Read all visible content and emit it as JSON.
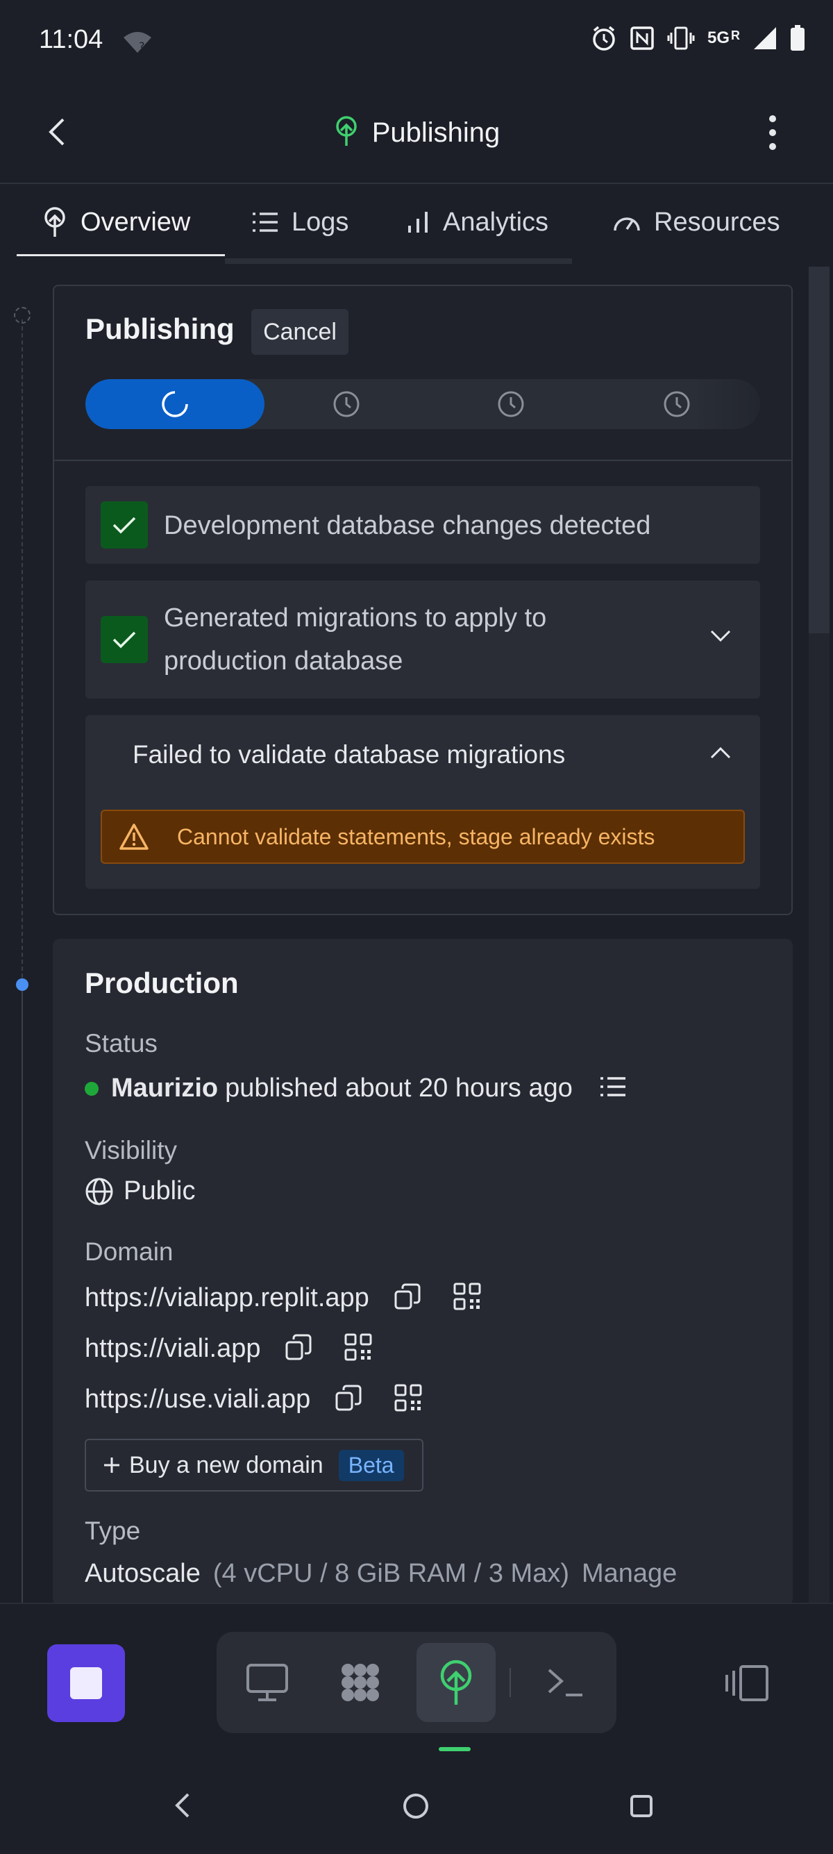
{
  "status_bar": {
    "time": "11:04",
    "network": "5G",
    "roaming": "R"
  },
  "header": {
    "title": "Publishing"
  },
  "tabs": [
    {
      "label": "Overview",
      "icon": "publish-tree-icon"
    },
    {
      "label": "Logs",
      "icon": "list-icon"
    },
    {
      "label": "Analytics",
      "icon": "bar-chart-icon"
    },
    {
      "label": "Resources",
      "icon": "gauge-icon"
    }
  ],
  "publishing": {
    "title": "Publishing",
    "cancel_label": "Cancel",
    "steps": [
      {
        "state": "in-progress",
        "icon": "spinner-icon"
      },
      {
        "state": "pending",
        "icon": "clock-icon"
      },
      {
        "state": "pending",
        "icon": "clock-icon"
      },
      {
        "state": "pending",
        "icon": "clock-icon"
      }
    ],
    "checks": [
      {
        "text": "Development database changes detected",
        "status": "done"
      },
      {
        "text_line1": "Generated migrations to apply to",
        "text_line2": "production database",
        "status": "done"
      }
    ],
    "failure": {
      "title": "Failed to validate database migrations",
      "error": "Cannot validate statements, stage already exists"
    }
  },
  "production": {
    "title": "Production",
    "status_label": "Status",
    "status_user": "Maurizio",
    "status_text": "published about 20 hours ago",
    "visibility_label": "Visibility",
    "visibility_value": "Public",
    "domain_label": "Domain",
    "domains": [
      "https://vialiapp.replit.app",
      "https://viali.app",
      "https://use.viali.app"
    ],
    "buy_domain_label": "Buy a new domain",
    "beta_label": "Beta",
    "type_label": "Type",
    "type_value": "Autoscale",
    "type_spec": "(4 vCPU / 8 GiB RAM / 3 Max)",
    "manage_label": "Manage"
  },
  "colors": {
    "accent_blue": "#0a5fc6",
    "success_green": "#0b5a1d",
    "warning_bg": "#5c2f05",
    "warning_text": "#f7b565",
    "stop_purple": "#5b3ee0",
    "active_green": "#3fd06f"
  }
}
